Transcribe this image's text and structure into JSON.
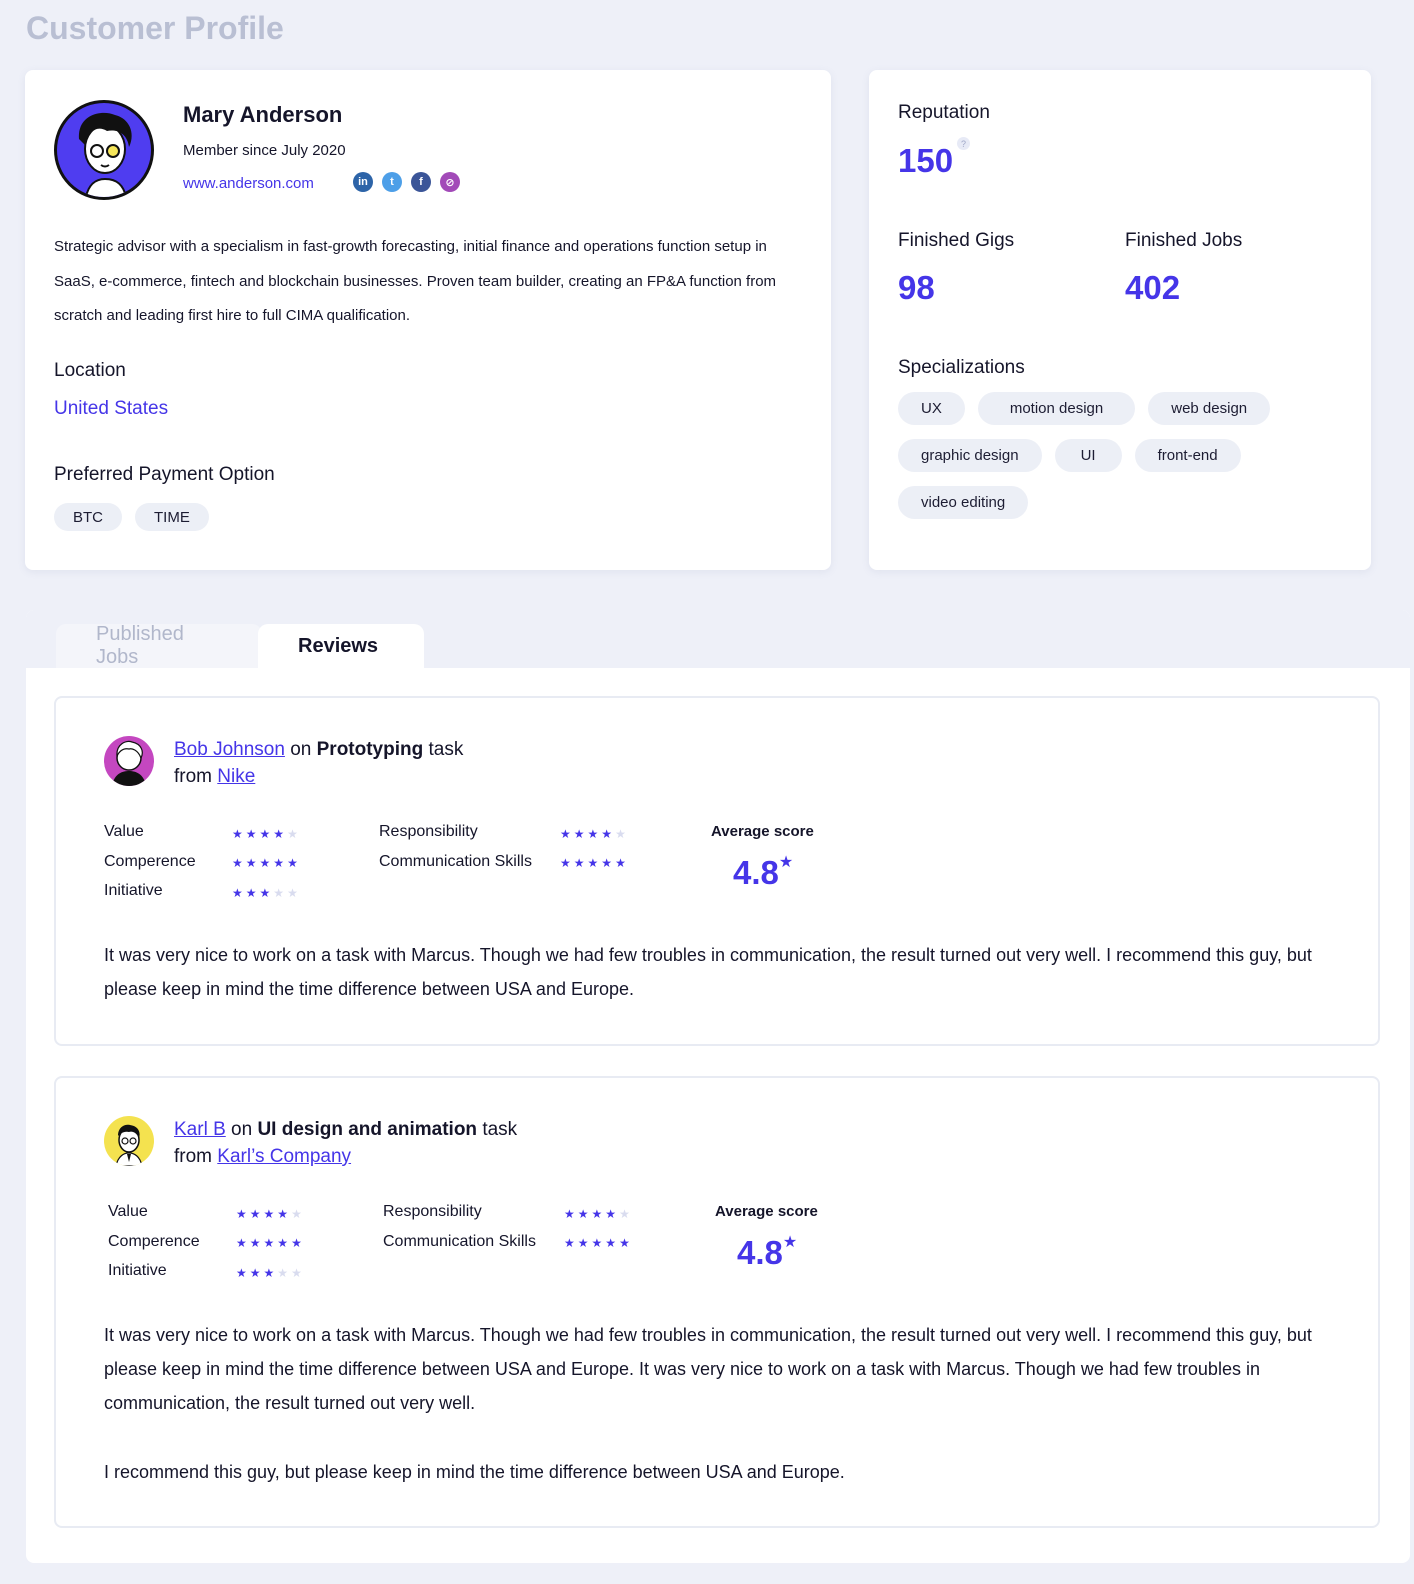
{
  "page": {
    "title": "Customer Profile"
  },
  "profile": {
    "name": "Mary Anderson",
    "member_since": "Member since July 2020",
    "website": "www.anderson.com",
    "socials": [
      {
        "name": "linkedin-icon",
        "glyph": "in",
        "color": "#2d64a8"
      },
      {
        "name": "twitter-icon",
        "glyph": "t",
        "color": "#4d9fe8"
      },
      {
        "name": "facebook-icon",
        "glyph": "f",
        "color": "#3b5598"
      },
      {
        "name": "dribbble-icon",
        "glyph": "⊘",
        "color": "#a24ab8"
      }
    ],
    "bio": "Strategic advisor with a specialism in fast-growth forecasting, initial finance and operations function setup in SaaS, e-commerce, fintech and blockchain businesses. Proven team builder, creating an FP&A function from scratch and leading first hire to full CIMA qualification.",
    "location_label": "Location",
    "location_value": "United States",
    "payment_label": "Preferred Payment Option",
    "payment_options": [
      "BTC",
      "TIME"
    ]
  },
  "stats": {
    "reputation_label": "Reputation",
    "reputation_value": "150",
    "help_glyph": "?",
    "gigs_label": "Finished Gigs",
    "gigs_value": "98",
    "jobs_label": "Finished Jobs",
    "jobs_value": "402",
    "spec_label": "Specializations",
    "specializations": [
      "UX",
      "motion design",
      "web design",
      "graphic design",
      "UI",
      "front-end",
      "video editing"
    ]
  },
  "tabs": {
    "published_jobs": "Published Jobs",
    "reviews": "Reviews"
  },
  "reviews": [
    {
      "reviewer": "Bob Johnson",
      "on_word": "on",
      "task": "Prototyping",
      "task_word": "task",
      "from_word": "from",
      "company": "Nike",
      "metrics": {
        "value_label": "Value",
        "value_stars": 4,
        "competence_label": "Comperence",
        "competence_stars": 5,
        "initiative_label": "Initiative",
        "initiative_stars": 3,
        "responsibility_label": "Responsibility",
        "responsibility_stars": 4,
        "communication_label": "Communication Skills",
        "communication_stars": 5
      },
      "avg_label": "Average score",
      "avg_value": "4.8",
      "body": [
        "It was very nice to work on a task with Marcus. Though we had few troubles in communication, the result turned out very well. I recommend this guy, but please keep in mind the time difference between USA and Europe."
      ]
    },
    {
      "reviewer": "Karl B",
      "on_word": "on",
      "task": "UI design and animation",
      "task_word": "task",
      "from_word": "from",
      "company": "Karl’s Company",
      "metrics": {
        "value_label": "Value",
        "value_stars": 4,
        "competence_label": "Comperence",
        "competence_stars": 5,
        "initiative_label": "Initiative",
        "initiative_stars": 3,
        "responsibility_label": "Responsibility",
        "responsibility_stars": 4,
        "communication_label": "Communication Skills",
        "communication_stars": 5
      },
      "avg_label": "Average score",
      "avg_value": "4.8",
      "body": [
        "It was very nice to work on a task with Marcus. Though we had few troubles in communication, the result turned out very well. I recommend this guy, but please keep in mind the time difference between USA and Europe. It was very nice to work on a task with Marcus. Though we had few troubles in communication, the result turned out very well.",
        "I recommend this guy, but please keep in mind the time difference between USA and Europe."
      ]
    }
  ],
  "star_glyph": "★",
  "colors": {
    "accent": "#4535e8",
    "background": "#eef0f8",
    "muted": "#b9bfd3"
  }
}
